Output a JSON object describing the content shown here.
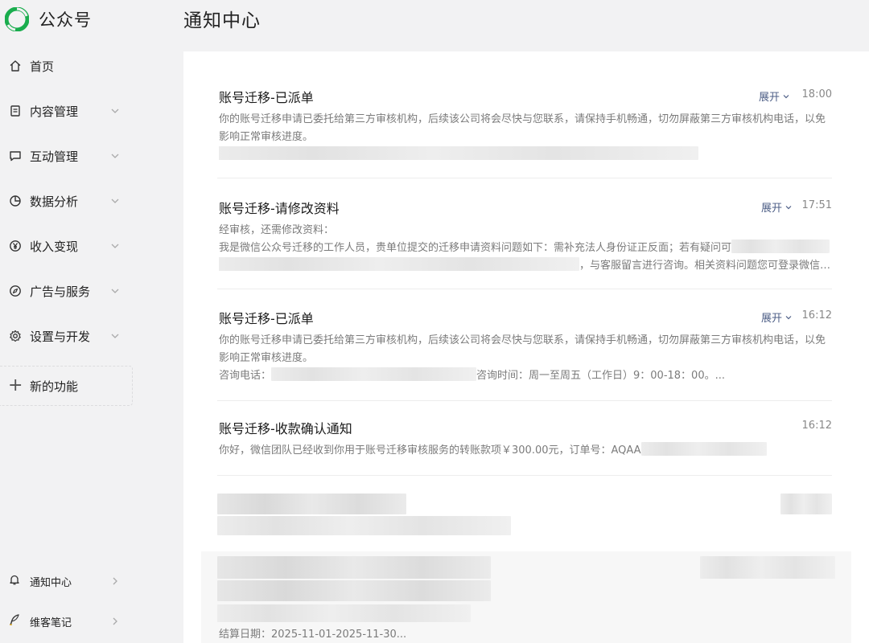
{
  "brand": {
    "name": "公众号"
  },
  "page_title": "通知中心",
  "nav": [
    {
      "label": "首页",
      "icon": "home-icon",
      "has_chevron": false
    },
    {
      "label": "内容管理",
      "icon": "document-icon",
      "has_chevron": true
    },
    {
      "label": "互动管理",
      "icon": "chat-icon",
      "has_chevron": true
    },
    {
      "label": "数据分析",
      "icon": "pie-chart-icon",
      "has_chevron": true
    },
    {
      "label": "收入变现",
      "icon": "yen-icon",
      "has_chevron": true
    },
    {
      "label": "广告与服务",
      "icon": "compass-icon",
      "has_chevron": true
    },
    {
      "label": "设置与开发",
      "icon": "gear-icon",
      "has_chevron": true
    }
  ],
  "new_feature": {
    "label": "新的功能",
    "icon": "plus-icon"
  },
  "bottom_nav": [
    {
      "label": "通知中心",
      "icon": "bell-icon"
    },
    {
      "label": "维客笔记",
      "icon": "feather-pen-icon"
    }
  ],
  "notices": [
    {
      "title": "账号迁移-已派单",
      "expand_label": "展开",
      "time": "18:00",
      "lines": [
        "你的账号迁移申请已委托给第三方审核机构，后续该公司将会尽快与您联系，请保持手机畅通，切勿屏蔽第三方审核机构电话，以免",
        "影响正常审核进度。"
      ]
    },
    {
      "title": "账号迁移-请修改资料",
      "expand_label": "展开",
      "time": "17:51",
      "lines": [
        "经审核，还需修改资料：",
        "我是微信公众号迁移的工作人员，贵单位提交的迁移申请资料问题如下：需补充法人身份证正反面；若有疑问可",
        "，与客服留言进行咨询。相关资料问题您可登录微信…"
      ]
    },
    {
      "title": "账号迁移-已派单",
      "expand_label": "展开",
      "time": "16:12",
      "lines": [
        "你的账号迁移申请已委托给第三方审核机构，后续该公司将会尽快与您联系，请保持手机畅通，切勿屏蔽第三方审核机构电话，以免",
        "影响正常审核进度。"
      ],
      "consult": {
        "phone_label": "咨询电话：",
        "hours_label": "咨询时间：周一至周五（工作日）9：00-18：00。..."
      }
    },
    {
      "title": "账号迁移-收款确认通知",
      "time": "16:12",
      "lines": [
        "你好，微信团队已经收到你用于账号迁移审核服务的转账款项￥300.00元，订单号：AQAA"
      ]
    }
  ],
  "settlement_text": "结算日期：2025-11-01-2025-11-30..."
}
